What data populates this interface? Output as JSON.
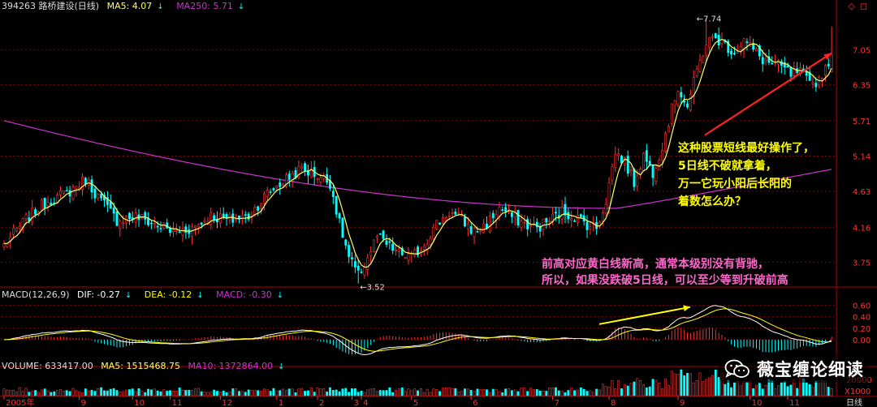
{
  "header": {
    "price": {
      "code_name": "394263 路桥建设(日线)",
      "ma5_label": "MA5: 4.07",
      "ma250_label": "MA250: 5.71"
    },
    "macd": {
      "title": "MACD(12,26,9)",
      "dif_label": "DIF: -0.27",
      "dea_label": "DEA: -0.12",
      "macd_label": "MACD: -0.30"
    },
    "volume": {
      "title": "VOLUME: 633417.00",
      "ma5_label": "MA5: 1515468.75",
      "ma10_label": "MA10: 1372864.00"
    }
  },
  "colors": {
    "up": "#ff3333",
    "down": "#00ffff",
    "ma5": "#ffff66",
    "ma250": "#cc33cc",
    "dif": "#ffffff",
    "dea": "#ffff00",
    "grid": "#8b0000",
    "axis_text": "#ff3333",
    "annotation_yellow": "#ffff00",
    "annotation_pink": "#ff66cc",
    "trendline": "#ff2222"
  },
  "annotations": {
    "yellow": [
      "这种股票短线最好操作了，",
      "5日线不破就拿着，",
      "万一它玩小阳后长阳的",
      "着数怎么办？"
    ],
    "pink": [
      "前高对应黄白线新高，通常本级别没有背驰，",
      "所以，如果没跌破5日线，可以至少等到升破前高"
    ],
    "high_label": "7.74",
    "low_label": "3.52"
  },
  "watermark": {
    "text": "薇宝缠论细读",
    "icon": "wechat-icon"
  },
  "chart_data": [
    {
      "type": "candlestick",
      "title": "394263 路桥建设(日线)",
      "y_ticks": [
        7.05,
        6.35,
        5.71,
        5.14,
        4.63,
        4.16,
        3.75
      ],
      "y_tick_labels": [
        "7.05",
        "6.35",
        "5.71",
        "5.14",
        "4.63",
        "4.16",
        "3.75"
      ],
      "ylim": [
        3.5,
        7.9
      ],
      "scale": "log",
      "series_ma250": {
        "name": "MA250",
        "start": 5.71,
        "min": 4.4,
        "end": 4.95
      },
      "anchors": [
        [
          0,
          3.95
        ],
        [
          8,
          4.3
        ],
        [
          14,
          4.5
        ],
        [
          20,
          4.6
        ],
        [
          26,
          4.8
        ],
        [
          30,
          4.55
        ],
        [
          36,
          4.25
        ],
        [
          42,
          4.3
        ],
        [
          48,
          4.2
        ],
        [
          54,
          4.1
        ],
        [
          60,
          4.15
        ],
        [
          66,
          4.3
        ],
        [
          72,
          4.25
        ],
        [
          78,
          4.3
        ],
        [
          84,
          4.6
        ],
        [
          90,
          4.8
        ],
        [
          95,
          4.95
        ],
        [
          100,
          4.85
        ],
        [
          104,
          4.75
        ],
        [
          107,
          4.2
        ],
        [
          110,
          3.8
        ],
        [
          113,
          3.6
        ],
        [
          116,
          3.8
        ],
        [
          119,
          4.05
        ],
        [
          122,
          3.95
        ],
        [
          126,
          3.85
        ],
        [
          130,
          3.8
        ],
        [
          134,
          3.95
        ],
        [
          138,
          4.2
        ],
        [
          142,
          4.35
        ],
        [
          146,
          4.25
        ],
        [
          150,
          4.1
        ],
        [
          154,
          4.2
        ],
        [
          158,
          4.4
        ],
        [
          162,
          4.3
        ],
        [
          166,
          4.2
        ],
        [
          170,
          4.15
        ],
        [
          174,
          4.25
        ],
        [
          178,
          4.35
        ],
        [
          182,
          4.3
        ],
        [
          186,
          4.2
        ],
        [
          189,
          4.15
        ],
        [
          192,
          4.5
        ],
        [
          195,
          5.2
        ],
        [
          198,
          5.05
        ],
        [
          201,
          4.75
        ],
        [
          204,
          5.15
        ],
        [
          207,
          4.9
        ],
        [
          210,
          5.3
        ],
        [
          213,
          5.9
        ],
        [
          215,
          6.3
        ],
        [
          218,
          5.95
        ],
        [
          221,
          6.6
        ],
        [
          224,
          7.2
        ],
        [
          227,
          7.3
        ],
        [
          230,
          7.15
        ],
        [
          233,
          7.0
        ],
        [
          236,
          7.25
        ],
        [
          239,
          7.05
        ],
        [
          242,
          6.85
        ],
        [
          245,
          6.75
        ],
        [
          248,
          6.7
        ],
        [
          251,
          6.55
        ],
        [
          254,
          6.6
        ],
        [
          257,
          6.35
        ],
        [
          260,
          6.45
        ],
        [
          262,
          6.7
        ],
        [
          264,
          6.95
        ]
      ]
    },
    {
      "type": "bar",
      "title": "MACD(12,26,9)",
      "y_ticks": [
        0.6,
        0.4,
        0.2,
        0.0
      ],
      "y_tick_labels": [
        "0.60",
        "0.40",
        "0.20",
        "0.00"
      ],
      "ylim": [
        -0.3,
        0.75
      ]
    },
    {
      "type": "bar",
      "title": "VOLUME",
      "y_ticks": [
        20000
      ],
      "y_tick_labels": [
        "20000"
      ],
      "unit_label": "X1000"
    },
    {
      "type": "axis",
      "x_tick_labels": [
        "2005年",
        "9",
        "10",
        "11",
        "12",
        "1",
        "2",
        "3",
        "4",
        "5",
        "6",
        "7",
        "8",
        "9",
        "10",
        "11"
      ],
      "x_ticks_at_bar": [
        0,
        24,
        41,
        53,
        69,
        87,
        100,
        111,
        114,
        130,
        149,
        175,
        193,
        215,
        238,
        250
      ],
      "period_label": "日线"
    }
  ]
}
